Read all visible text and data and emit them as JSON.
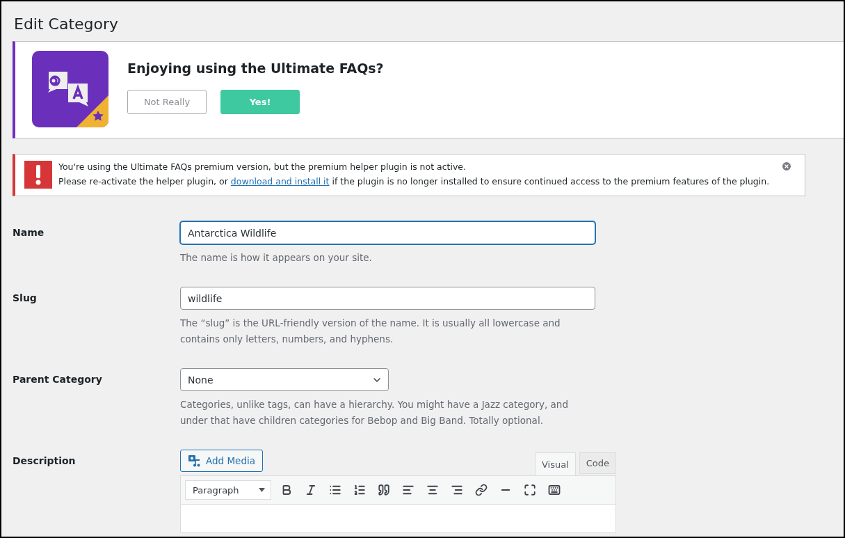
{
  "page_title": "Edit Category",
  "review_banner": {
    "question": "Enjoying using the Ultimate FAQs?",
    "buttons": [
      {
        "label": "Not Really",
        "kind": "secondary"
      },
      {
        "label": "Yes!",
        "kind": "primary"
      }
    ]
  },
  "notice": {
    "line_1": "You're using the Ultimate FAQs premium version, but the premium helper plugin is not active.",
    "line_2_before": "Please re-activate the helper plugin, or",
    "link": "download and install it",
    "line_2_after": "if the plugin is no longer installed to ensure continued access to the premium features of the plugin."
  },
  "fields": [
    {
      "kind": "text",
      "label": "Name",
      "value": "Antarctica Wildlife",
      "focused": true,
      "help": [
        "The name is how it appears on your site."
      ]
    },
    {
      "kind": "text",
      "label": "Slug",
      "value": "wildlife",
      "focused": false,
      "help": [
        "The “slug” is the URL-friendly version of the name. It is usually all lowercase and",
        "contains only letters, numbers, and hyphens."
      ]
    },
    {
      "kind": "select",
      "label": "Parent Category",
      "value": "None",
      "help": [
        "Categories, unlike tags, can have a hierarchy. You might have a Jazz category, and",
        "under that have children categories for Bebop and Big Band. Totally optional."
      ]
    },
    {
      "kind": "editor",
      "label": "Description",
      "add_media": "Add Media",
      "tabs": [
        {
          "label": "Visual",
          "selected": true
        },
        {
          "label": "Code",
          "selected": false
        }
      ],
      "format": "Paragraph"
    }
  ]
}
